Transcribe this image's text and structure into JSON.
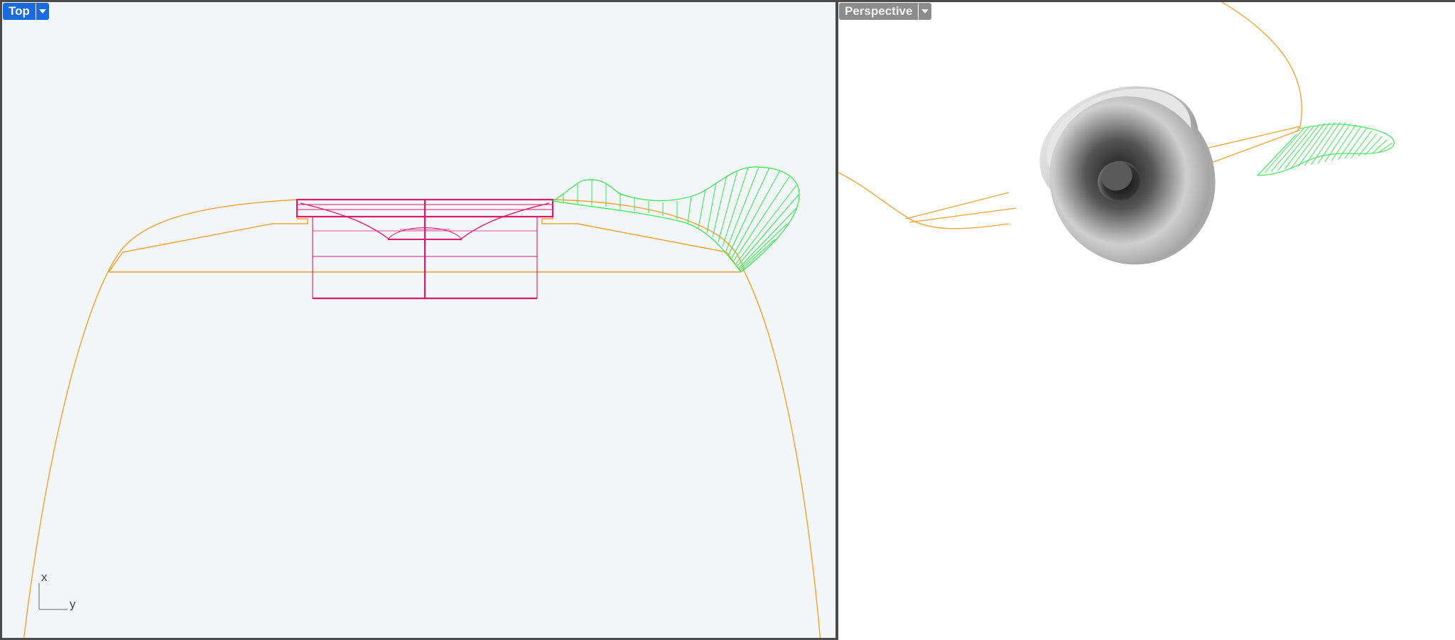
{
  "viewports": {
    "top": {
      "title": "Top",
      "active": true
    },
    "perspective": {
      "title": "Perspective",
      "active": false
    }
  },
  "axis_gizmo": {
    "x_label": "x",
    "y_label": "y"
  },
  "colors": {
    "top_background": "#f3f6f9",
    "perspective_background": "#ffffff",
    "active_tab": "#1a6be0",
    "inactive_tab": "#8c8c8c",
    "orange_curve": "#f5a02a",
    "magenta_geometry": "#e0186a",
    "green_surface": "#2ee84a",
    "frame": "#4a4a4a"
  },
  "icons": {
    "dropdown": "chevron-down-icon"
  }
}
